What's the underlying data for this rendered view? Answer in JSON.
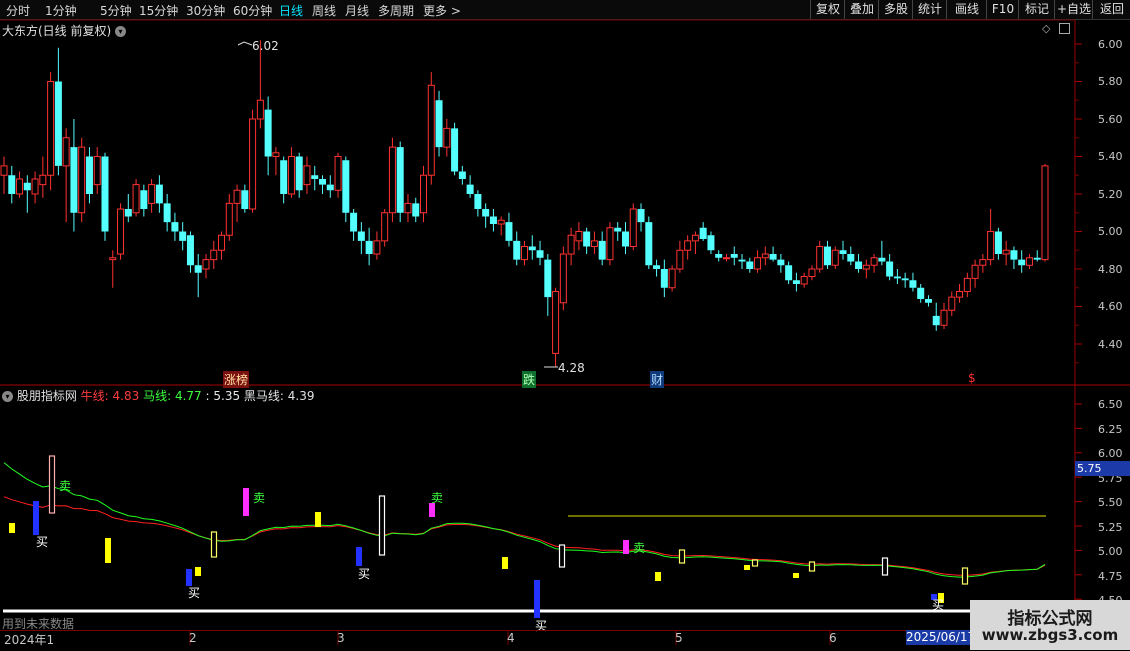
{
  "toolbar": {
    "periods": [
      "分时",
      "1分钟",
      "5分钟",
      "15分钟",
      "30分钟",
      "60分钟",
      "日线",
      "周线",
      "月线",
      "多周期",
      "更多 >"
    ],
    "active_period": "日线",
    "right_buttons": [
      "复权",
      "叠加",
      "多股",
      "统计",
      "画线",
      "F10",
      "标记",
      "+自选",
      "返回"
    ]
  },
  "main_chart": {
    "title": "大东方(日线 前复权)",
    "high_label": "6.02",
    "low_label": "4.28",
    "events": [
      "涨榜",
      "跌",
      "财",
      "$"
    ],
    "y_ticks": [
      "6.00",
      "5.80",
      "5.60",
      "5.40",
      "5.20",
      "5.00",
      "4.80",
      "4.60",
      "4.40"
    ]
  },
  "indicator": {
    "name": "股朋指标网",
    "niu_label": "牛线:",
    "niu_value": "4.83",
    "ma_label": "马线:",
    "ma_value": "4.77",
    "extra_value": ": 5.35",
    "heima_label": "黑马线:",
    "heima_value": "4.39",
    "y_ticks": [
      "6.50",
      "6.25",
      "6.00",
      "5.75",
      "5.50",
      "5.25",
      "5.00",
      "4.75",
      "4.50"
    ],
    "current_label": "5.75",
    "buy_label": "买",
    "sell_label": "卖",
    "future_note": "用到未来数据"
  },
  "dates": {
    "start": "2024年1",
    "months": [
      "2",
      "3",
      "4",
      "5",
      "6"
    ],
    "highlight": "2025/06/17"
  },
  "watermark": {
    "line1": "指标公式网",
    "line2": "www.zbgs3.com"
  },
  "colors": {
    "up": "#ff3232",
    "down": "#54ffff",
    "niu": "#ff2020",
    "ma": "#20ff20",
    "accent": "#00e5ff"
  },
  "chart_data": {
    "type": "candlestick",
    "title": "大东方(日线 前复权)",
    "ylim": [
      4.2,
      6.1
    ],
    "candles": [
      [
        5.3,
        5.4,
        5.2,
        5.35
      ],
      [
        5.3,
        5.35,
        5.15,
        5.2
      ],
      [
        5.2,
        5.32,
        5.18,
        5.28
      ],
      [
        5.26,
        5.3,
        5.1,
        5.22
      ],
      [
        5.2,
        5.32,
        5.15,
        5.28
      ],
      [
        5.25,
        5.4,
        5.18,
        5.3
      ],
      [
        5.3,
        5.85,
        5.22,
        5.8
      ],
      [
        5.8,
        5.98,
        5.3,
        5.35
      ],
      [
        5.35,
        5.55,
        5.05,
        5.5
      ],
      [
        5.45,
        5.6,
        5.0,
        5.1
      ],
      [
        5.1,
        5.5,
        5.05,
        5.45
      ],
      [
        5.4,
        5.45,
        5.15,
        5.2
      ],
      [
        5.25,
        5.45,
        5.2,
        5.4
      ],
      [
        5.4,
        5.42,
        4.95,
        5.0
      ],
      [
        4.85,
        4.9,
        4.7,
        4.86
      ],
      [
        4.88,
        5.15,
        4.85,
        5.12
      ],
      [
        5.12,
        5.2,
        5.05,
        5.08
      ],
      [
        5.1,
        5.28,
        5.08,
        5.25
      ],
      [
        5.22,
        5.25,
        5.08,
        5.12
      ],
      [
        5.15,
        5.28,
        5.1,
        5.25
      ],
      [
        5.25,
        5.3,
        5.1,
        5.15
      ],
      [
        5.15,
        5.2,
        5.0,
        5.05
      ],
      [
        5.05,
        5.1,
        4.95,
        5.0
      ],
      [
        5.0,
        5.05,
        4.9,
        4.95
      ],
      [
        4.98,
        5.0,
        4.78,
        4.82
      ],
      [
        4.82,
        4.88,
        4.65,
        4.78
      ],
      [
        4.8,
        4.88,
        4.75,
        4.85
      ],
      [
        4.85,
        4.95,
        4.8,
        4.9
      ],
      [
        4.9,
        5.0,
        4.85,
        4.98
      ],
      [
        4.98,
        5.2,
        4.95,
        5.15
      ],
      [
        5.15,
        5.25,
        5.05,
        5.22
      ],
      [
        5.22,
        5.25,
        5.1,
        5.12
      ],
      [
        5.12,
        5.65,
        5.1,
        5.6
      ],
      [
        5.6,
        6.02,
        5.55,
        5.7
      ],
      [
        5.65,
        5.72,
        5.3,
        5.4
      ],
      [
        5.4,
        5.45,
        5.3,
        5.42
      ],
      [
        5.38,
        5.4,
        5.15,
        5.2
      ],
      [
        5.2,
        5.45,
        5.18,
        5.4
      ],
      [
        5.4,
        5.42,
        5.18,
        5.22
      ],
      [
        5.25,
        5.4,
        5.2,
        5.35
      ],
      [
        5.3,
        5.35,
        5.22,
        5.28
      ],
      [
        5.28,
        5.3,
        5.2,
        5.25
      ],
      [
        5.25,
        5.3,
        5.18,
        5.22
      ],
      [
        5.22,
        5.42,
        5.18,
        5.4
      ],
      [
        5.38,
        5.4,
        5.05,
        5.1
      ],
      [
        5.1,
        5.12,
        4.95,
        5.0
      ],
      [
        5.0,
        5.05,
        4.88,
        4.95
      ],
      [
        4.95,
        5.02,
        4.82,
        4.88
      ],
      [
        4.88,
        5.0,
        4.85,
        4.95
      ],
      [
        4.95,
        5.12,
        4.92,
        5.1
      ],
      [
        5.1,
        5.5,
        5.05,
        5.45
      ],
      [
        5.45,
        5.48,
        5.05,
        5.1
      ],
      [
        5.1,
        5.2,
        5.05,
        5.15
      ],
      [
        5.15,
        5.18,
        5.05,
        5.08
      ],
      [
        5.1,
        5.35,
        5.05,
        5.3
      ],
      [
        5.3,
        5.85,
        5.25,
        5.78
      ],
      [
        5.7,
        5.75,
        5.4,
        5.45
      ],
      [
        5.45,
        5.6,
        5.4,
        5.55
      ],
      [
        5.55,
        5.58,
        5.3,
        5.32
      ],
      [
        5.32,
        5.35,
        5.25,
        5.28
      ],
      [
        5.25,
        5.3,
        5.18,
        5.2
      ],
      [
        5.2,
        5.22,
        5.08,
        5.12
      ],
      [
        5.12,
        5.15,
        5.02,
        5.08
      ],
      [
        5.08,
        5.12,
        5.0,
        5.04
      ],
      [
        5.04,
        5.08,
        4.98,
        5.06
      ],
      [
        5.05,
        5.1,
        4.92,
        4.95
      ],
      [
        4.95,
        5.0,
        4.82,
        4.85
      ],
      [
        4.85,
        4.95,
        4.82,
        4.92
      ],
      [
        4.92,
        4.98,
        4.85,
        4.9
      ],
      [
        4.9,
        4.95,
        4.82,
        4.86
      ],
      [
        4.85,
        4.88,
        4.55,
        4.65
      ],
      [
        4.35,
        4.7,
        4.28,
        4.68
      ],
      [
        4.62,
        4.92,
        4.58,
        4.88
      ],
      [
        4.88,
        5.02,
        4.82,
        4.98
      ],
      [
        4.95,
        5.05,
        4.9,
        5.0
      ],
      [
        5.0,
        5.02,
        4.88,
        4.92
      ],
      [
        4.92,
        5.0,
        4.88,
        4.95
      ],
      [
        4.95,
        5.0,
        4.82,
        4.85
      ],
      [
        4.85,
        5.05,
        4.82,
        5.02
      ],
      [
        5.02,
        5.05,
        4.95,
        5.0
      ],
      [
        5.0,
        5.05,
        4.88,
        4.92
      ],
      [
        4.92,
        5.15,
        4.9,
        5.12
      ],
      [
        5.12,
        5.15,
        5.0,
        5.05
      ],
      [
        5.05,
        5.08,
        4.8,
        4.82
      ],
      [
        4.82,
        4.85,
        4.76,
        4.8
      ],
      [
        4.8,
        4.85,
        4.65,
        4.7
      ],
      [
        4.7,
        4.82,
        4.68,
        4.8
      ],
      [
        4.8,
        4.95,
        4.78,
        4.9
      ],
      [
        4.9,
        4.98,
        4.85,
        4.95
      ],
      [
        4.95,
        5.0,
        4.88,
        4.98
      ],
      [
        5.02,
        5.05,
        4.95,
        4.96
      ],
      [
        4.98,
        5.0,
        4.88,
        4.9
      ],
      [
        4.88,
        4.9,
        4.84,
        4.86
      ],
      [
        4.86,
        4.88,
        4.84,
        4.86
      ],
      [
        4.88,
        4.92,
        4.82,
        4.86
      ],
      [
        4.85,
        4.88,
        4.8,
        4.84
      ],
      [
        4.84,
        4.86,
        4.78,
        4.8
      ],
      [
        4.8,
        4.9,
        4.78,
        4.86
      ],
      [
        4.86,
        4.92,
        4.82,
        4.88
      ],
      [
        4.88,
        4.92,
        4.84,
        4.85
      ],
      [
        4.85,
        4.88,
        4.78,
        4.82
      ],
      [
        4.82,
        4.84,
        4.72,
        4.74
      ],
      [
        4.74,
        4.78,
        4.68,
        4.72
      ],
      [
        4.72,
        4.78,
        4.7,
        4.76
      ],
      [
        4.76,
        4.82,
        4.74,
        4.8
      ],
      [
        4.8,
        4.95,
        4.78,
        4.92
      ],
      [
        4.92,
        4.95,
        4.8,
        4.82
      ],
      [
        4.82,
        4.92,
        4.8,
        4.9
      ],
      [
        4.9,
        4.95,
        4.85,
        4.88
      ],
      [
        4.88,
        4.92,
        4.82,
        4.84
      ],
      [
        4.84,
        4.88,
        4.78,
        4.8
      ],
      [
        4.8,
        4.85,
        4.75,
        4.82
      ],
      [
        4.82,
        4.88,
        4.78,
        4.86
      ],
      [
        4.86,
        4.95,
        4.82,
        4.84
      ],
      [
        4.84,
        4.88,
        4.74,
        4.76
      ],
      [
        4.76,
        4.8,
        4.72,
        4.75
      ],
      [
        4.75,
        4.78,
        4.7,
        4.74
      ],
      [
        4.74,
        4.78,
        4.68,
        4.7
      ],
      [
        4.7,
        4.72,
        4.62,
        4.64
      ],
      [
        4.64,
        4.66,
        4.6,
        4.62
      ],
      [
        4.55,
        4.62,
        4.47,
        4.5
      ],
      [
        4.5,
        4.62,
        4.48,
        4.58
      ],
      [
        4.58,
        4.68,
        4.55,
        4.65
      ],
      [
        4.65,
        4.72,
        4.62,
        4.68
      ],
      [
        4.68,
        4.78,
        4.65,
        4.75
      ],
      [
        4.75,
        4.85,
        4.7,
        4.82
      ],
      [
        4.82,
        4.88,
        4.78,
        4.85
      ],
      [
        4.85,
        5.12,
        4.82,
        5.0
      ],
      [
        5.0,
        5.02,
        4.85,
        4.88
      ],
      [
        4.88,
        4.95,
        4.82,
        4.9
      ],
      [
        4.9,
        4.92,
        4.8,
        4.85
      ],
      [
        4.85,
        4.9,
        4.78,
        4.82
      ],
      [
        4.82,
        4.88,
        4.8,
        4.86
      ],
      [
        4.86,
        4.9,
        4.84,
        4.85
      ],
      [
        4.85,
        5.36,
        4.84,
        5.35
      ]
    ]
  }
}
